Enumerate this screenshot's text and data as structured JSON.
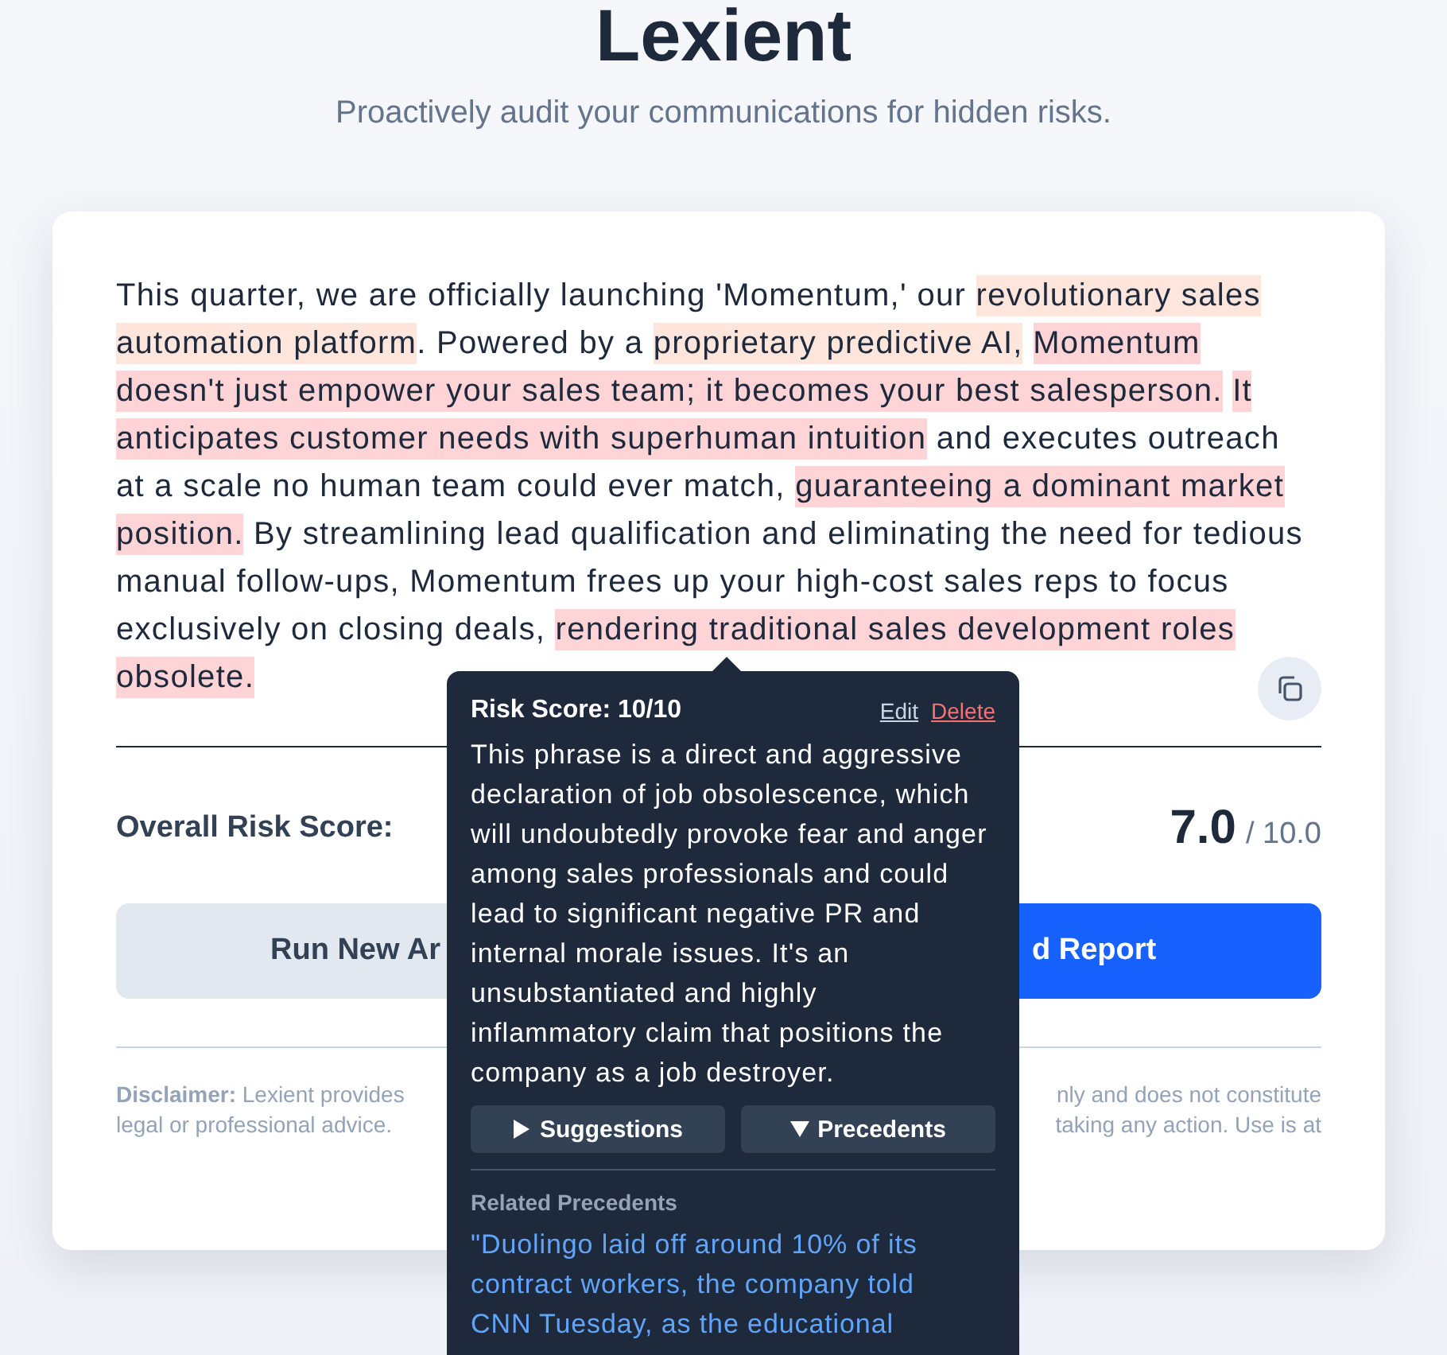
{
  "header": {
    "title": "Lexient",
    "subtitle": "Proactively audit your communications for hidden risks."
  },
  "document": {
    "segments": [
      {
        "kind": "text",
        "text": "This quarter, we are officially launching 'Momentum,' our "
      },
      {
        "kind": "highlight",
        "color": "#ffe6dc",
        "text": "revolutionary sales automation platform"
      },
      {
        "kind": "text",
        "text": ". Powered by a "
      },
      {
        "kind": "highlight",
        "color": "#ffe6dc",
        "text": "proprietary predictive AI,"
      },
      {
        "kind": "highlight",
        "color": "#ffd4d6",
        "text": "Momentum doesn't just empower your sales team; it becomes your best salesperson."
      },
      {
        "kind": "highlight",
        "color": "#ffd4d6",
        "text": "It anticipates customer needs with superhuman intuition"
      },
      {
        "kind": "text",
        "text": " and executes outreach at a scale no human team could ever match, "
      },
      {
        "kind": "highlight",
        "color": "#ffd4d6",
        "text": "guaranteeing a dominant market position."
      },
      {
        "kind": "text",
        "text": " By streamlining lead qualification and eliminating the need for tedious manual follow-ups, Momentum frees up your high-cost sales reps to focus exclusively on closing deals, "
      },
      {
        "kind": "highlight",
        "color": "#ffd4d6",
        "text": "rendering traditional sales development roles obsolete."
      }
    ]
  },
  "overall": {
    "label": "Overall Risk Score:",
    "score": "7.0",
    "max": "/ 10.0"
  },
  "buttons": [
    {
      "kind": "secondary",
      "label": "Run New Ar"
    },
    {
      "kind": "primary",
      "label": "d Report"
    }
  ],
  "disclaimer": {
    "left": [
      "**Disclaimer:** Lexient provides",
      "legal or professional advice."
    ],
    "right": [
      "nly and does not constitute",
      "taking any action. Use is at"
    ]
  },
  "tooltip": {
    "title": "Risk Score: 10/10",
    "edit": "Edit",
    "delete": "Delete",
    "explanation": "This phrase is a direct and aggressive declaration of job obsolescence, which will undoubtedly provoke fear and anger among sales professionals and could lead to significant negative PR and internal morale issues. It's an unsubstantiated and highly inflammatory claim that positions the company as a job destroyer.",
    "toggles": [
      {
        "label": "Suggestions",
        "expanded": false
      },
      {
        "label": "Precedents",
        "expanded": true
      }
    ],
    "precedents_heading": "Related Precedents",
    "precedent": "\"Duolingo laid off around 10% of its contract workers, the company told CNN Tuesday, as the educational"
  }
}
